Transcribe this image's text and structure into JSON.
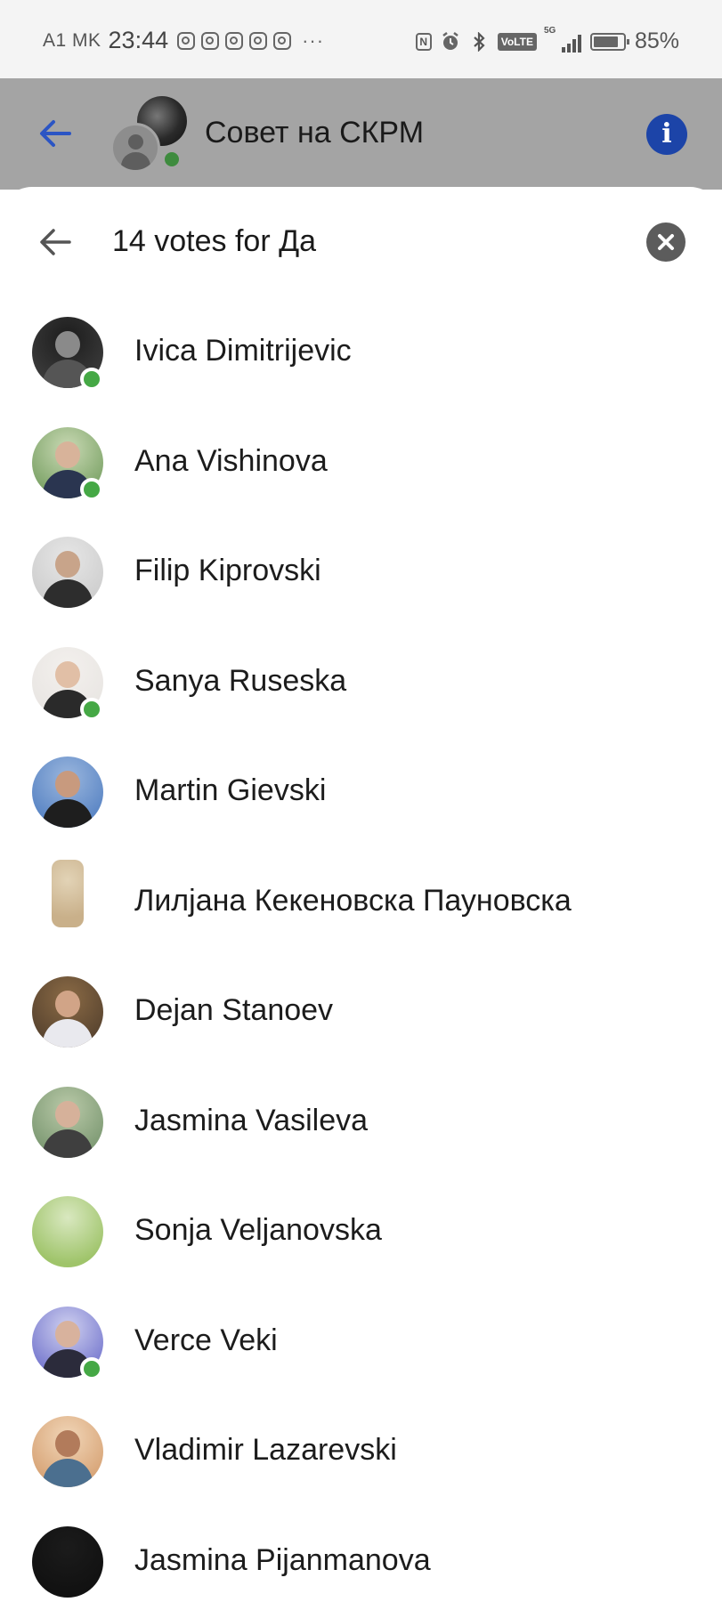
{
  "status_bar": {
    "carrier": "A1 MK",
    "time": "23:44",
    "more_indicator": "···",
    "network": "5G",
    "volte": "VoLTE",
    "battery_percent": "85%",
    "battery_level": 0.85,
    "icons": [
      "instagram-icon",
      "instagram-icon",
      "instagram-icon",
      "instagram-icon",
      "instagram-icon",
      "nfc-icon",
      "alarm-icon",
      "bluetooth-icon",
      "volte-icon",
      "signal-icon",
      "battery-icon"
    ]
  },
  "header": {
    "title": "Совет на СКРМ",
    "online_color": "#3e8b3e",
    "info_color": "#1c44a8"
  },
  "sheet": {
    "title": "14 votes for Да",
    "back_icon": "arrow-left-icon",
    "close_icon": "close-icon"
  },
  "voters": [
    {
      "name": "Ivica Dimitrijevic",
      "online": true,
      "avatar": "dark"
    },
    {
      "name": "Ana Vishinova",
      "online": true,
      "avatar": "green"
    },
    {
      "name": "Filip Kiprovski",
      "online": false,
      "avatar": "grey"
    },
    {
      "name": "Sanya Ruseska",
      "online": true,
      "avatar": "light"
    },
    {
      "name": "Martin Gievski",
      "online": false,
      "avatar": "blue"
    },
    {
      "name": "Лилјана Кекеновска Пауновска",
      "online": false,
      "avatar": "rect"
    },
    {
      "name": "Dejan Stanoev",
      "online": false,
      "avatar": "warm"
    },
    {
      "name": "Jasmina Vasileva",
      "online": false,
      "avatar": "plant"
    },
    {
      "name": "Sonja Veljanovska",
      "online": false,
      "avatar": "butterfly"
    },
    {
      "name": "Verce Veki",
      "online": true,
      "avatar": "purple"
    },
    {
      "name": "Vladimir Lazarevski",
      "online": false,
      "avatar": "beach"
    },
    {
      "name": "Jasmina Pijanmanova",
      "online": false,
      "avatar": "black"
    }
  ],
  "colors": {
    "online_dot": "#45a845",
    "sheet_background": "#ffffff",
    "dimmed_header": "#a4a4a4"
  }
}
